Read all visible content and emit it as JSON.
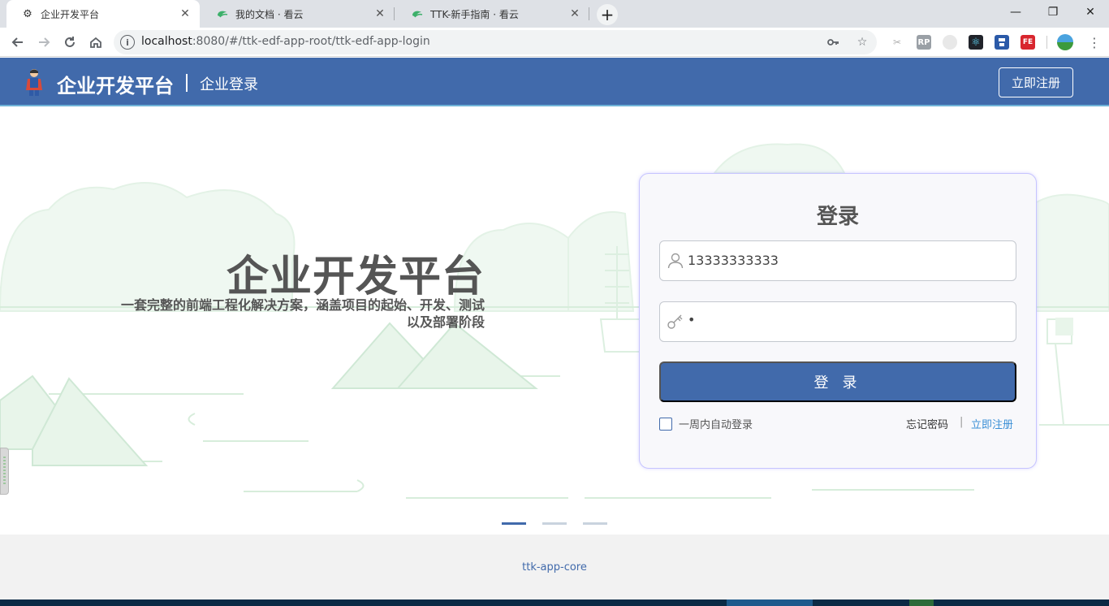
{
  "browser": {
    "tabs": [
      {
        "title": "企业开发平台",
        "icon": "gear-icon",
        "active": true
      },
      {
        "title": "我的文档 · 看云",
        "icon": "kancloud-icon",
        "active": false
      },
      {
        "title": "TTK-新手指南 · 看云",
        "icon": "kancloud-icon",
        "active": false
      }
    ],
    "url_host": "localhost",
    "url_rest": ":8080/#/ttk-edf-app-root/ttk-edf-app-login",
    "extensions": [
      {
        "icon": "extension-grey-icon",
        "label": "",
        "color": "#b0b0b0"
      },
      {
        "icon": "rp-extension-icon",
        "label": "RP",
        "color": "#9aa0a6"
      },
      {
        "icon": "circle-extension-icon",
        "label": "",
        "color": "#d0d0d0"
      },
      {
        "icon": "react-devtools-icon",
        "label": "⚛",
        "color": "#20232a"
      },
      {
        "icon": "save-extension-icon",
        "label": "",
        "color": "#2b5aa8"
      },
      {
        "icon": "fe-extension-icon",
        "label": "FE",
        "color": "#d8262e"
      }
    ]
  },
  "header": {
    "brand": "企业开发平台",
    "subtitle": "企业登录",
    "register_label": "立即注册"
  },
  "hero": {
    "title": "企业开发平台",
    "desc_line1": "一套完整的前端工程化解决方案，涵盖项目的起始、开发、测试",
    "desc_line2": "以及部署阶段"
  },
  "login": {
    "title": "登录",
    "phone_value": "13333333333",
    "password_value": "•",
    "submit_label": "登 录",
    "remember_label": "一周内自动登录",
    "forgot_label": "忘记密码",
    "separator": "|",
    "register_link": "立即注册"
  },
  "carousel": {
    "count": 3,
    "active_index": 0
  },
  "footer": {
    "text": "ttk-app-core"
  },
  "colors": {
    "brand_blue": "#416aab",
    "header_bottom": "#6fb3d8",
    "link_blue": "#3a8fd6",
    "card_border": "#c6c4ff"
  }
}
